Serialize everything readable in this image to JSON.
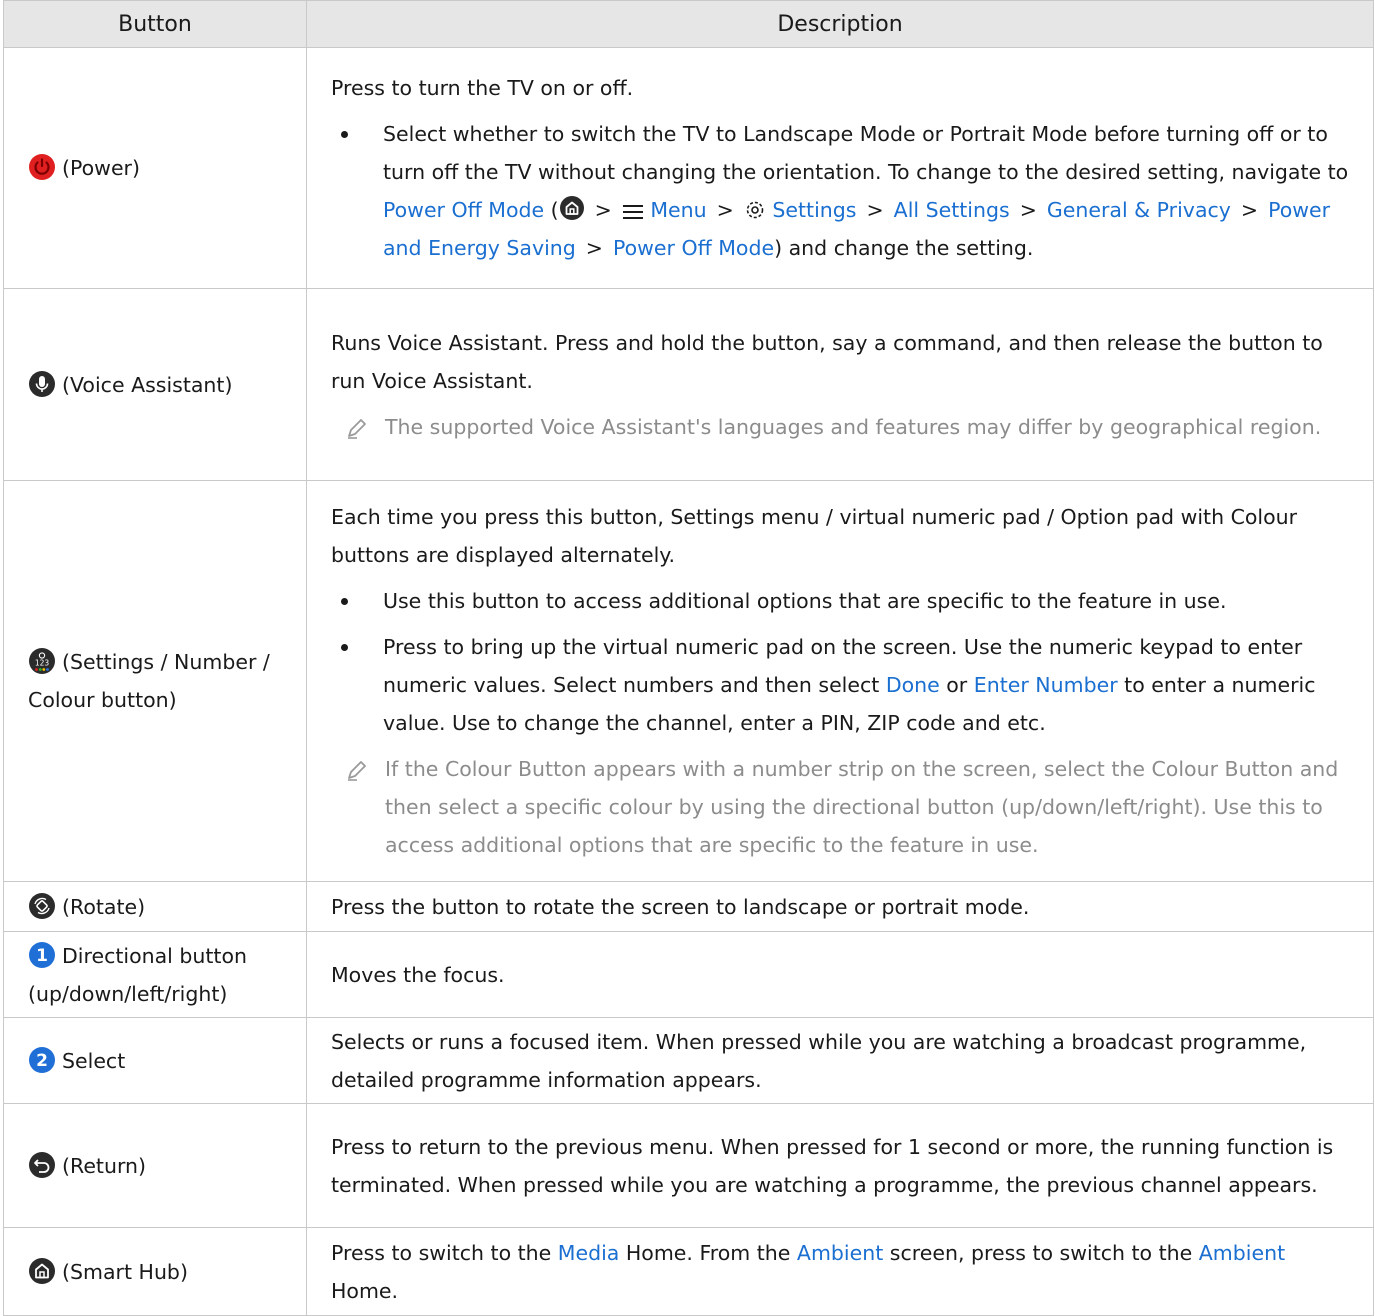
{
  "header": {
    "col_button": "Button",
    "col_description": "Description"
  },
  "rows": {
    "power": {
      "label": "(Power)",
      "intro": "Press to turn the TV on or off.",
      "bullet_a": "Select whether to switch the TV to Landscape Mode or Portrait Mode before turning off or to turn off the TV without changing the orientation. To change to the desired setting, navigate to ",
      "link_power_off": "Power Off Mode",
      "open_paren": " (",
      "close_paren": ")",
      "link_menu": "Menu",
      "link_settings": "Settings",
      "link_all_settings": "All Settings",
      "link_general": "General & Privacy",
      "link_power_energy": "Power and Energy Saving",
      "link_power_off2": "Power Off Mode",
      "tail": ") and change the setting.",
      "sep": ">"
    },
    "voice": {
      "label": "(Voice Assistant)",
      "text": "Runs Voice Assistant. Press and hold the button, say a command, and then release the button to run Voice Assistant.",
      "note": "The supported Voice Assistant's languages and features may differ by geographical region."
    },
    "settings": {
      "label": "(Settings / Number / Colour button)",
      "text": "Each time you press this button, Settings menu / virtual numeric pad / Option pad with Colour buttons are displayed alternately.",
      "bullet_1": "Use this button to access additional options that are specific to the feature in use.",
      "bullet_2a": "Press to bring up the virtual numeric pad on the screen. Use the numeric keypad to enter numeric values. Select numbers and then select ",
      "link_done": "Done",
      "or": " or ",
      "link_enter": "Enter Number",
      "bullet_2b": " to enter a numeric value. Use to change the channel, enter a PIN, ZIP code and etc.",
      "note": "If the Colour Button appears with a number strip on the screen, select the Colour Button and then select a specific colour by using the directional button (up/down/left/right). Use this to access additional options that are specific to the feature in use."
    },
    "rotate": {
      "label": "(Rotate)",
      "text": "Press the button to rotate the screen to landscape or portrait mode."
    },
    "directional": {
      "num": "1",
      "label": "Directional button (up/down/left/right)",
      "text": "Moves the focus."
    },
    "select": {
      "num": "2",
      "label": "Select",
      "text": "Selects or runs a focused item. When pressed while you are watching a broadcast programme, detailed programme information appears."
    },
    "return": {
      "label": "(Return)",
      "text": "Press to return to the previous menu. When pressed for 1 second or more, the running function is terminated. When pressed while you are watching a programme, the previous channel appears."
    },
    "smarthub": {
      "label": "(Smart Hub)",
      "t1": "Press to switch to the ",
      "link_media": "Media",
      "t2": " Home. From the ",
      "link_ambient1": "Ambient",
      "t3": " screen, press to switch to the ",
      "link_ambient2": "Ambient",
      "t4": " Home."
    }
  },
  "colors": {
    "link": "#1a6fd1",
    "note": "#8c8c8c",
    "header_bg": "#e6e6e6",
    "power_red": "#e02020",
    "icon_dark": "#2b2b2b",
    "badge_blue": "#1f6fd6"
  },
  "icons": [
    "power-icon",
    "microphone-icon",
    "settings-number-icon",
    "rotate-icon",
    "number-badge-1",
    "number-badge-2",
    "return-icon",
    "home-icon",
    "pen-icon",
    "gear-icon",
    "menu-icon"
  ]
}
